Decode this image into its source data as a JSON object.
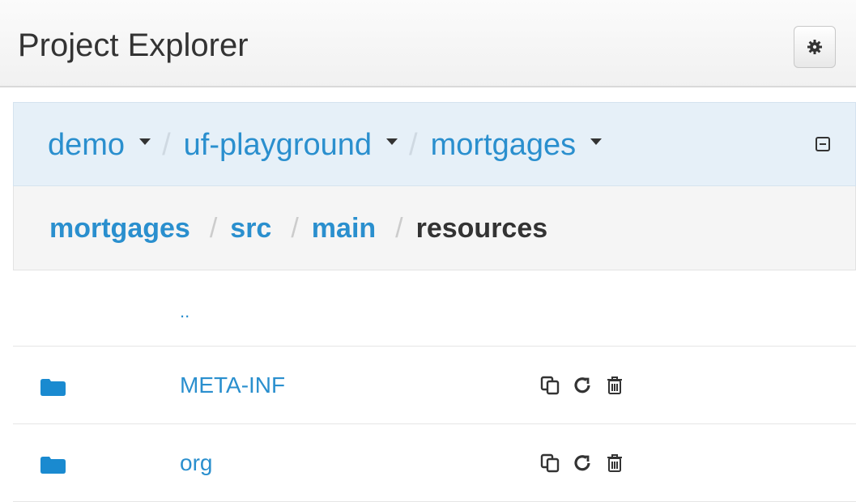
{
  "panel": {
    "title": "Project Explorer",
    "settings_icon": "gear-icon"
  },
  "project_breadcrumb": {
    "items": [
      {
        "label": "demo",
        "has_dropdown": true
      },
      {
        "label": "uf-playground",
        "has_dropdown": true
      },
      {
        "label": "mortgages",
        "has_dropdown": true
      }
    ],
    "separator": "/",
    "collapse_icon": "collapse-icon"
  },
  "path_breadcrumb": {
    "items": [
      {
        "label": "mortgages",
        "link": true
      },
      {
        "label": "src",
        "link": true
      },
      {
        "label": "main",
        "link": true
      },
      {
        "label": "resources",
        "link": false
      }
    ],
    "separator": "/"
  },
  "listing": {
    "up_dir": "..",
    "rows": [
      {
        "name": "META-INF",
        "icon": "folder-icon",
        "actions": [
          "copy-icon",
          "rename-icon",
          "delete-icon"
        ]
      },
      {
        "name": "org",
        "icon": "folder-icon",
        "actions": [
          "copy-icon",
          "rename-icon",
          "delete-icon"
        ]
      }
    ]
  },
  "colors": {
    "link": "#2a8fce",
    "project_bar_bg": "#e6f0f8",
    "path_bar_bg": "#f5f5f5",
    "folder": "#1a8ad0"
  }
}
